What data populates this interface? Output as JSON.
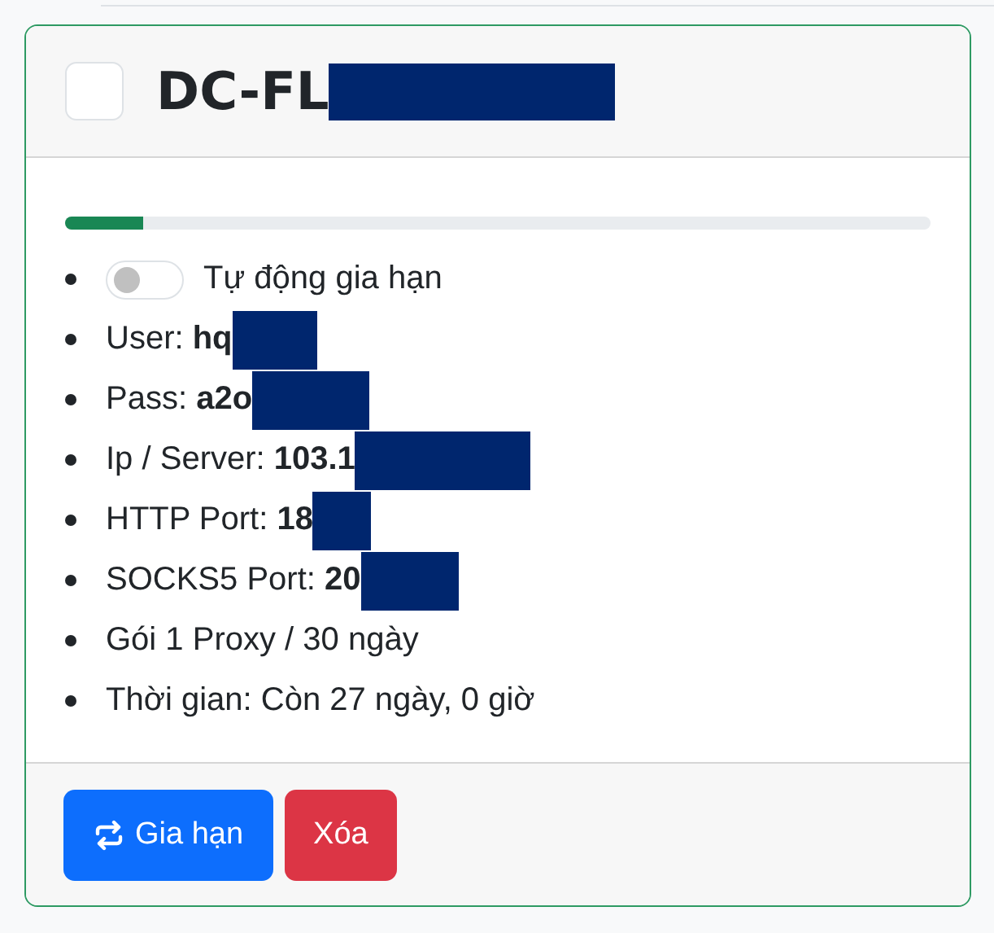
{
  "card": {
    "checked": false,
    "title": "DC-FL",
    "title_redacted": true,
    "progress": {
      "level": 0.09
    },
    "items": [
      {
        "kind": "switch",
        "on": false,
        "label": "Tự động gia hạn"
      },
      {
        "kind": "detail",
        "label": "User:",
        "value": "hq",
        "redacted": true
      },
      {
        "kind": "detail",
        "label": "Pass:",
        "value": "a2o",
        "redacted": true
      },
      {
        "kind": "detail",
        "label": "Ip / Server:",
        "value": "103.1",
        "redacted": true
      },
      {
        "kind": "detail",
        "label": "HTTP Port:",
        "value": "18",
        "redacted": true
      },
      {
        "kind": "detail",
        "label": "SOCKS5 Port:",
        "value": "20",
        "redacted": true
      },
      {
        "kind": "text",
        "label": "Gói 1 Proxy / 30 ngày"
      },
      {
        "kind": "text",
        "label": "Thời gian: Còn 27 ngày, 0 giờ"
      }
    ],
    "buttons": [
      {
        "kind": "renew",
        "label": "Gia hạn"
      },
      {
        "kind": "delete",
        "label": "Xóa"
      }
    ]
  }
}
